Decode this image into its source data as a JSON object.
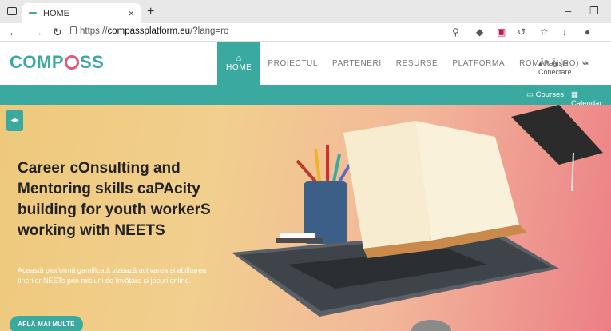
{
  "browser": {
    "tab_title": "HOME",
    "url_prefix": "https://",
    "url_host": "compassplatform.eu",
    "url_path": "/?lang=ro",
    "new_tab": "+",
    "tab_close": "×"
  },
  "site": {
    "logo_pre": "COMP",
    "logo_post": "SS",
    "menu": [
      {
        "label": "HOME",
        "icon": "home-icon"
      },
      {
        "label": "PROIECTUL"
      },
      {
        "label": "PARTENERI"
      },
      {
        "label": "RESURSE"
      },
      {
        "label": "PLATFORMA"
      },
      {
        "label": "ROMÂNĂ (RO) ˅"
      }
    ],
    "register": "Register",
    "login": "Conectare",
    "courses": "Courses",
    "calendar": "Calendar"
  },
  "hero": {
    "title": "Career cOnsulting and Mentoring skills caPAcity building for youth workerS working with NEETS",
    "desc": "Această platformă gamificată vizează activarea și abilitarea tinerilor NEETs prin misiuni de învățare și jocuri online.",
    "button": "AFLĂ MAI MULTE"
  },
  "colors": {
    "accent": "#3aa99f",
    "logo_ring": "#e5567a"
  }
}
